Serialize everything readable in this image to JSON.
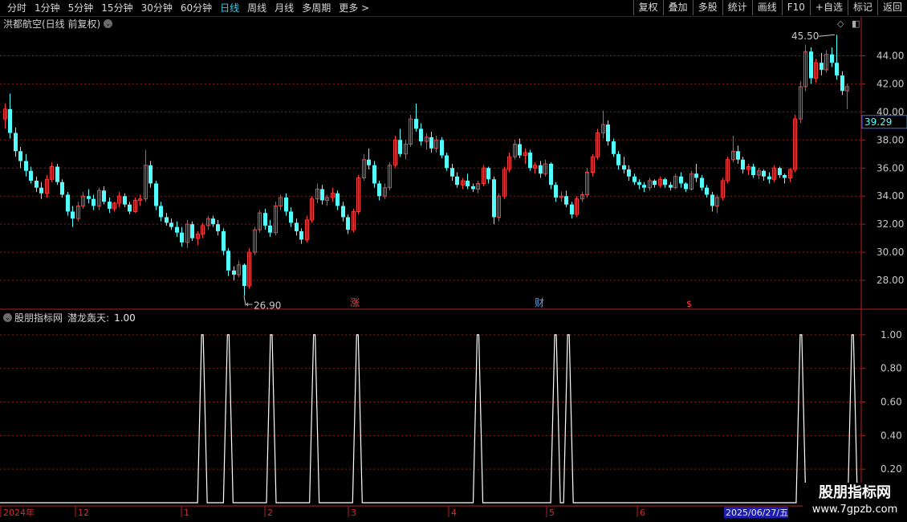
{
  "toolbar": {
    "periods": [
      "分时",
      "1分钟",
      "5分钟",
      "15分钟",
      "30分钟",
      "60分钟",
      "日线",
      "周线",
      "月线",
      "多周期",
      "更多 >"
    ],
    "active_period": "日线",
    "actions": [
      "复权",
      "叠加",
      "多股",
      "统计",
      "画线",
      "F10",
      "+自选",
      "标记",
      "返回"
    ]
  },
  "stock": {
    "title": "洪都航空(日线 前复权)",
    "high_label": "45.50",
    "low_label": "26.90",
    "current_price": "39.29"
  },
  "price_axis": {
    "ticks": [
      "44.00",
      "42.00",
      "40.00",
      "38.00",
      "36.00",
      "34.00",
      "32.00",
      "30.00",
      "28.00"
    ]
  },
  "markers": {
    "zhang": "涨",
    "cai": "财",
    "s": "$"
  },
  "indicator": {
    "title": "股朋指标网",
    "name": "潜龙轰天:",
    "value": "1.00",
    "ticks": [
      "1.00",
      "0.80",
      "0.60",
      "0.40",
      "0.20"
    ]
  },
  "time_axis": {
    "labels": [
      "2024年",
      "12",
      "1",
      "2",
      "3",
      "4",
      "5",
      "6"
    ],
    "cursor_date": "2025/06/27/五"
  },
  "watermark": {
    "title": "股朋指标网",
    "url": "www.7gpzb.com"
  },
  "colors": {
    "up": "#ff3c3c",
    "down": "#54ffff",
    "grid": "#8a1a1a",
    "axis": "#b02020",
    "signal": "#ffffff"
  },
  "chart_data": {
    "type": "candlestick",
    "price_range": [
      26.0,
      45.8
    ],
    "candles": [
      [
        39.5,
        40.6,
        38.8,
        40.2
      ],
      [
        40.2,
        41.3,
        38.1,
        38.5
      ],
      [
        38.5,
        38.9,
        36.8,
        37.2
      ],
      [
        37.2,
        37.5,
        36.0,
        36.5
      ],
      [
        36.5,
        37.0,
        35.4,
        35.8
      ],
      [
        35.8,
        36.1,
        34.9,
        35.1
      ],
      [
        35.1,
        35.4,
        34.3,
        34.6
      ],
      [
        34.6,
        35.0,
        33.8,
        34.2
      ],
      [
        34.2,
        35.5,
        33.9,
        35.2
      ],
      [
        35.2,
        36.4,
        35.0,
        36.1
      ],
      [
        36.1,
        36.3,
        34.8,
        35.0
      ],
      [
        35.0,
        35.2,
        33.9,
        34.1
      ],
      [
        34.1,
        34.3,
        32.6,
        32.9
      ],
      [
        32.9,
        33.3,
        31.8,
        32.4
      ],
      [
        32.4,
        33.6,
        32.2,
        33.3
      ],
      [
        33.3,
        34.3,
        33.1,
        34.0
      ],
      [
        34.0,
        34.5,
        33.5,
        33.8
      ],
      [
        33.8,
        34.1,
        33.0,
        33.3
      ],
      [
        33.3,
        34.6,
        33.0,
        34.4
      ],
      [
        34.4,
        34.7,
        33.4,
        33.6
      ],
      [
        33.6,
        33.9,
        32.8,
        33.1
      ],
      [
        33.1,
        33.6,
        32.9,
        33.5
      ],
      [
        33.5,
        34.3,
        33.2,
        34.0
      ],
      [
        34.0,
        34.2,
        33.2,
        33.4
      ],
      [
        33.4,
        33.6,
        32.7,
        32.9
      ],
      [
        32.9,
        33.9,
        32.8,
        33.7
      ],
      [
        33.7,
        34.1,
        33.3,
        33.8
      ],
      [
        33.8,
        37.3,
        33.6,
        36.2
      ],
      [
        36.2,
        36.5,
        34.6,
        34.9
      ],
      [
        34.9,
        35.1,
        33.0,
        33.3
      ],
      [
        33.3,
        33.6,
        32.2,
        32.5
      ],
      [
        32.5,
        32.8,
        31.9,
        32.1
      ],
      [
        32.1,
        32.4,
        31.6,
        31.8
      ],
      [
        31.8,
        32.2,
        31.1,
        31.4
      ],
      [
        31.4,
        31.8,
        30.4,
        30.7
      ],
      [
        30.7,
        32.3,
        30.3,
        32.0
      ],
      [
        32.0,
        32.2,
        30.8,
        31.0
      ],
      [
        31.0,
        31.5,
        30.5,
        31.3
      ],
      [
        31.3,
        32.1,
        31.0,
        31.9
      ],
      [
        31.9,
        32.6,
        31.6,
        32.4
      ],
      [
        32.4,
        32.6,
        31.8,
        32.0
      ],
      [
        32.0,
        32.3,
        31.2,
        31.5
      ],
      [
        31.5,
        31.7,
        29.8,
        30.1
      ],
      [
        30.1,
        30.3,
        28.3,
        28.7
      ],
      [
        28.7,
        29.0,
        28.0,
        28.4
      ],
      [
        28.4,
        29.4,
        28.2,
        29.1
      ],
      [
        29.1,
        29.2,
        26.9,
        27.6
      ],
      [
        27.6,
        30.3,
        27.4,
        30.0
      ],
      [
        30.0,
        31.8,
        29.8,
        31.6
      ],
      [
        31.6,
        33.0,
        31.4,
        32.8
      ],
      [
        32.8,
        33.1,
        31.6,
        31.9
      ],
      [
        31.9,
        32.3,
        31.1,
        31.4
      ],
      [
        31.4,
        33.6,
        31.2,
        33.3
      ],
      [
        33.3,
        34.1,
        33.0,
        33.9
      ],
      [
        33.9,
        34.2,
        32.6,
        32.9
      ],
      [
        32.9,
        33.2,
        31.8,
        32.1
      ],
      [
        32.1,
        32.4,
        31.2,
        31.5
      ],
      [
        31.5,
        31.7,
        30.6,
        30.9
      ],
      [
        30.9,
        32.6,
        30.7,
        32.3
      ],
      [
        32.3,
        34.0,
        32.1,
        33.8
      ],
      [
        33.8,
        34.9,
        33.5,
        34.5
      ],
      [
        34.5,
        34.8,
        33.4,
        33.7
      ],
      [
        33.7,
        34.1,
        33.3,
        33.9
      ],
      [
        33.9,
        34.6,
        33.6,
        34.2
      ],
      [
        34.2,
        34.4,
        33.0,
        33.3
      ],
      [
        33.3,
        33.6,
        32.2,
        32.5
      ],
      [
        32.5,
        32.7,
        31.3,
        31.6
      ],
      [
        31.6,
        33.1,
        31.4,
        32.9
      ],
      [
        32.9,
        35.5,
        32.7,
        35.3
      ],
      [
        35.3,
        37.0,
        35.1,
        36.6
      ],
      [
        36.6,
        37.4,
        35.9,
        36.2
      ],
      [
        36.2,
        36.5,
        34.6,
        34.9
      ],
      [
        34.9,
        35.1,
        33.7,
        34.0
      ],
      [
        34.0,
        34.9,
        33.8,
        34.6
      ],
      [
        34.6,
        36.4,
        34.4,
        36.2
      ],
      [
        36.2,
        38.3,
        36.0,
        38.0
      ],
      [
        38.0,
        38.8,
        36.8,
        37.0
      ],
      [
        37.0,
        38.0,
        36.6,
        37.7
      ],
      [
        37.7,
        39.8,
        37.5,
        39.5
      ],
      [
        39.5,
        40.6,
        38.6,
        38.8
      ],
      [
        38.8,
        39.2,
        37.6,
        37.9
      ],
      [
        37.9,
        38.5,
        37.3,
        38.2
      ],
      [
        38.2,
        38.6,
        37.1,
        37.4
      ],
      [
        37.4,
        38.3,
        37.1,
        38.0
      ],
      [
        38.0,
        38.2,
        36.7,
        36.9
      ],
      [
        36.9,
        37.1,
        35.8,
        36.0
      ],
      [
        36.0,
        36.3,
        35.1,
        35.4
      ],
      [
        35.4,
        35.7,
        34.6,
        34.8
      ],
      [
        34.8,
        35.3,
        34.5,
        35.1
      ],
      [
        35.1,
        35.6,
        34.5,
        34.7
      ],
      [
        34.7,
        34.9,
        34.3,
        34.5
      ],
      [
        34.5,
        35.1,
        34.2,
        34.9
      ],
      [
        34.9,
        36.2,
        34.7,
        36.0
      ],
      [
        36.0,
        36.1,
        34.9,
        35.2
      ],
      [
        35.2,
        35.4,
        32.0,
        32.5
      ],
      [
        32.5,
        34.2,
        32.2,
        34.0
      ],
      [
        34.0,
        36.1,
        33.8,
        35.9
      ],
      [
        35.9,
        37.1,
        35.7,
        36.8
      ],
      [
        36.8,
        38.0,
        36.6,
        37.7
      ],
      [
        37.7,
        38.1,
        36.7,
        36.9
      ],
      [
        36.9,
        37.4,
        36.3,
        37.1
      ],
      [
        37.1,
        37.3,
        35.8,
        36.0
      ],
      [
        36.0,
        36.4,
        35.6,
        36.2
      ],
      [
        36.2,
        36.5,
        35.3,
        35.6
      ],
      [
        35.6,
        36.6,
        35.4,
        36.3
      ],
      [
        36.3,
        36.4,
        34.5,
        34.8
      ],
      [
        34.8,
        35.0,
        33.6,
        33.9
      ],
      [
        33.9,
        34.3,
        33.6,
        34.0
      ],
      [
        34.0,
        34.4,
        33.2,
        33.4
      ],
      [
        33.4,
        33.6,
        32.4,
        32.7
      ],
      [
        32.7,
        34.0,
        32.5,
        33.8
      ],
      [
        33.8,
        34.3,
        33.6,
        34.1
      ],
      [
        34.1,
        36.0,
        33.9,
        35.7
      ],
      [
        35.7,
        37.0,
        35.4,
        36.8
      ],
      [
        36.8,
        38.8,
        36.6,
        38.5
      ],
      [
        38.5,
        40.1,
        38.1,
        39.1
      ],
      [
        39.1,
        39.4,
        37.6,
        37.9
      ],
      [
        37.9,
        38.1,
        36.8,
        37.0
      ],
      [
        37.0,
        37.2,
        35.9,
        36.2
      ],
      [
        36.2,
        36.8,
        35.6,
        35.9
      ],
      [
        35.9,
        36.2,
        35.1,
        35.4
      ],
      [
        35.4,
        35.6,
        34.8,
        35.0
      ],
      [
        35.0,
        35.2,
        34.5,
        34.8
      ],
      [
        34.8,
        35.0,
        34.3,
        34.6
      ],
      [
        34.6,
        35.3,
        34.4,
        35.1
      ],
      [
        35.1,
        35.2,
        34.6,
        34.8
      ],
      [
        34.8,
        35.4,
        34.6,
        35.2
      ],
      [
        35.2,
        35.3,
        34.6,
        34.8
      ],
      [
        34.8,
        35.0,
        34.4,
        34.6
      ],
      [
        34.6,
        35.6,
        34.5,
        35.4
      ],
      [
        35.4,
        35.7,
        34.6,
        34.9
      ],
      [
        34.9,
        35.0,
        34.3,
        34.5
      ],
      [
        34.5,
        35.8,
        34.4,
        35.6
      ],
      [
        35.6,
        36.3,
        35.0,
        35.3
      ],
      [
        35.3,
        35.5,
        34.4,
        34.6
      ],
      [
        34.6,
        34.8,
        33.9,
        34.1
      ],
      [
        34.1,
        34.3,
        32.9,
        33.3
      ],
      [
        33.3,
        34.1,
        32.8,
        33.9
      ],
      [
        33.9,
        35.3,
        33.7,
        35.1
      ],
      [
        35.1,
        36.8,
        34.9,
        36.6
      ],
      [
        36.6,
        38.3,
        36.4,
        37.2
      ],
      [
        37.2,
        37.6,
        36.3,
        36.6
      ],
      [
        36.6,
        36.8,
        35.6,
        35.9
      ],
      [
        35.9,
        36.3,
        35.5,
        36.1
      ],
      [
        36.1,
        36.3,
        35.3,
        35.5
      ],
      [
        35.5,
        36.0,
        35.2,
        35.8
      ],
      [
        35.8,
        35.9,
        35.1,
        35.4
      ],
      [
        35.4,
        35.7,
        34.9,
        35.2
      ],
      [
        35.2,
        36.2,
        35.0,
        36.0
      ],
      [
        36.0,
        36.1,
        35.3,
        35.5
      ],
      [
        35.5,
        35.6,
        34.9,
        35.3
      ],
      [
        35.3,
        36.0,
        35.0,
        35.9
      ],
      [
        35.9,
        39.8,
        35.7,
        39.5
      ],
      [
        39.5,
        42.2,
        39.2,
        41.8
      ],
      [
        41.8,
        44.8,
        41.5,
        44.3
      ],
      [
        44.3,
        44.6,
        42.0,
        42.4
      ],
      [
        42.4,
        43.8,
        42.1,
        43.5
      ],
      [
        43.5,
        44.2,
        42.6,
        43.0
      ],
      [
        43.0,
        44.4,
        42.8,
        44.1
      ],
      [
        44.1,
        44.6,
        43.2,
        43.5
      ],
      [
        43.5,
        45.5,
        42.3,
        42.6
      ],
      [
        42.6,
        42.9,
        41.2,
        41.5
      ],
      [
        41.5,
        42.0,
        40.2,
        41.8
      ]
    ],
    "signal_pulses": [
      0.235,
      0.265,
      0.315,
      0.365,
      0.415,
      0.555,
      0.645,
      0.66,
      0.93,
      0.99
    ],
    "indicator_range": [
      0,
      1.1
    ]
  }
}
